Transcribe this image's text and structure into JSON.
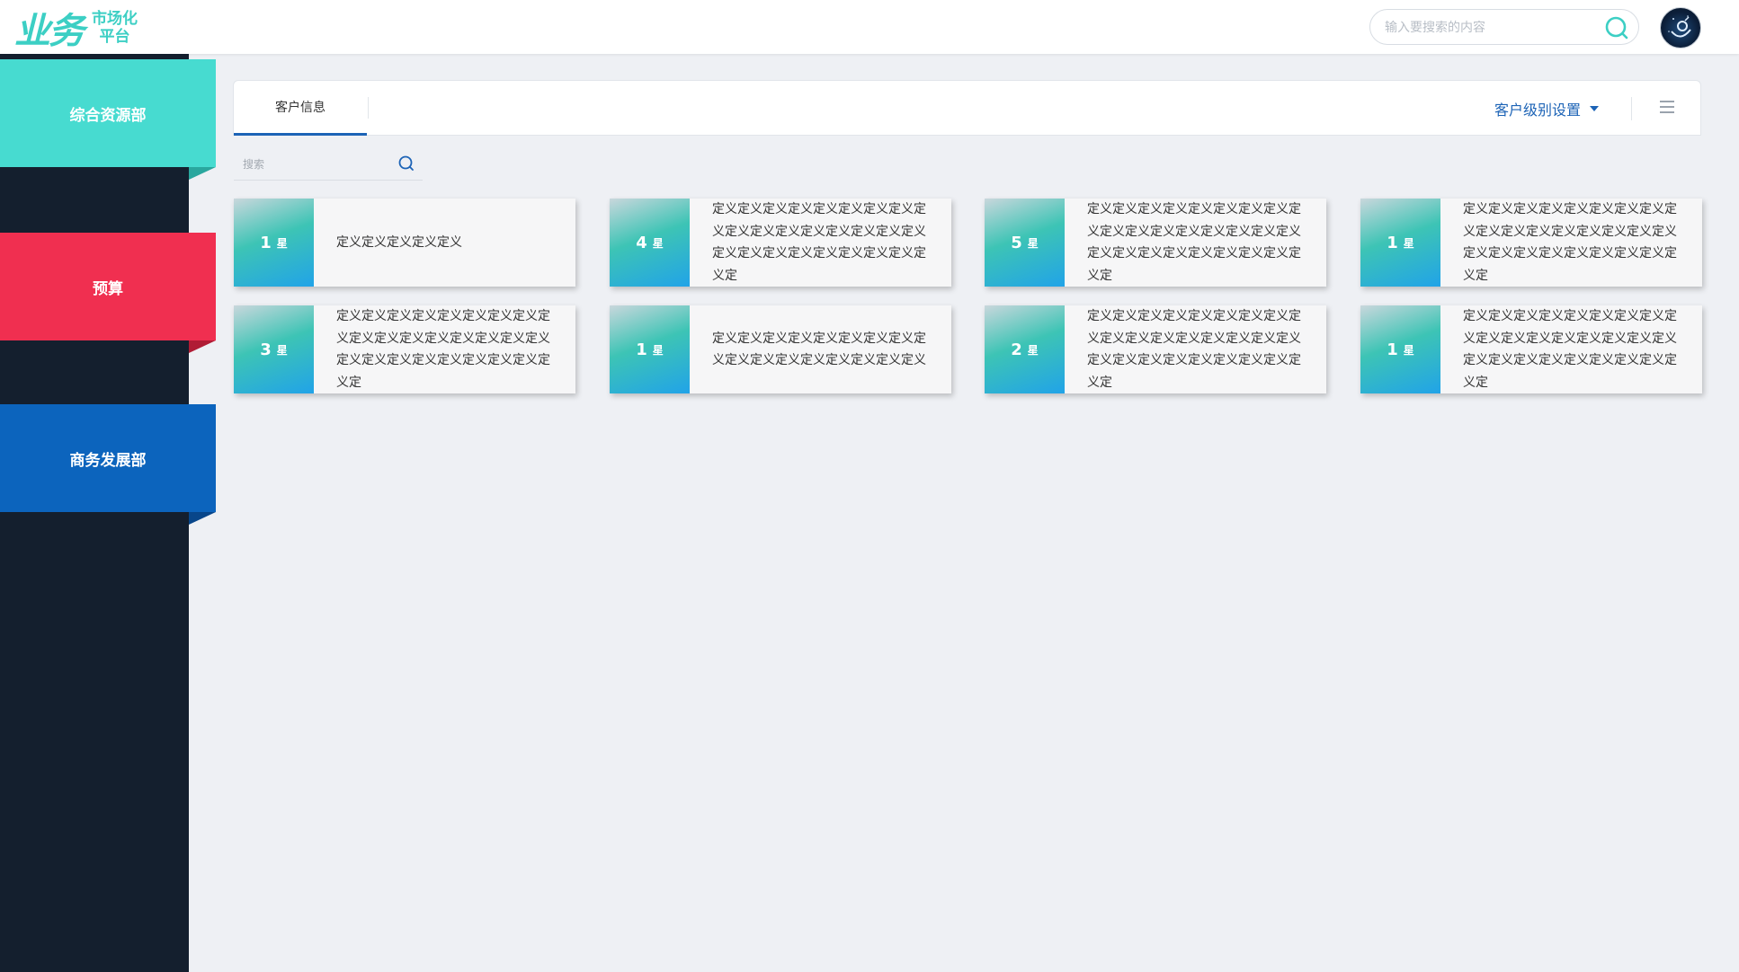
{
  "header": {
    "logo_mark": "业务",
    "logo_sub_line1": "市场化",
    "logo_sub_line2": "平台",
    "search_placeholder": "输入要搜索的内容",
    "accent": "#3ccfc4"
  },
  "sidebar": {
    "items": [
      {
        "label": "综合资源部",
        "color": "#47dbd0"
      },
      {
        "label": "预算",
        "color": "#f02f50"
      },
      {
        "label": "商务发展部",
        "color": "#0c64bd"
      }
    ]
  },
  "tabs": {
    "active_label": "客户信息",
    "level_setting_label": "客户级别设置"
  },
  "filter": {
    "search_placeholder": "搜索"
  },
  "cards": [
    {
      "count": "1",
      "unit": "星",
      "text": "定义定义定义定义定义"
    },
    {
      "count": "4",
      "unit": "星",
      "text": "定义定义定义定义定义定义定义定义定义定义定义定义定义定义定义定义定义定义定义定义定义定义定义定义定义定义定"
    },
    {
      "count": "5",
      "unit": "星",
      "text": "定义定义定义定义定义定义定义定义定义定义定义定义定义定义定义定义定义定义定义定义定义定义定义定义定义定义定"
    },
    {
      "count": "1",
      "unit": "星",
      "text": "定义定义定义定义定义定义定义定义定义定义定义定义定义定义定义定义定义定义定义定义定义定义定义定义定义定义定"
    },
    {
      "count": "3",
      "unit": "星",
      "text": "定义定义定义定义定义定义定义定义定义定义定义定义定义定义定义定义定义定义定义定义定义定义定义定义定义定义定"
    },
    {
      "count": "1",
      "unit": "星",
      "text": "定义定义定义定义定义定义定义定义定义定义定义定义定义定义定义定义定义"
    },
    {
      "count": "2",
      "unit": "星",
      "text": "定义定义定义定义定义定义定义定义定义定义定义定义定义定义定义定义定义定义定义定义定义定义定义定义定义定义定"
    },
    {
      "count": "1",
      "unit": "星",
      "text": "定义定义定义定义定义定义定义定义定义定义定义定义定义定义定义定义定义定义定义定义定义定义定义定义定义定义定"
    }
  ]
}
